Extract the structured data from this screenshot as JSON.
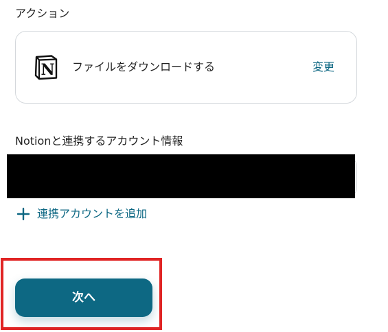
{
  "action_section": {
    "heading": "アクション",
    "app_icon": "notion-icon",
    "action_name": "ファイルをダウンロードする",
    "change_label": "変更"
  },
  "account_section": {
    "heading": "Notionと連携するアカウント情報",
    "add_account_label": "連携アカウントを追加",
    "add_icon": "plus-icon"
  },
  "footer": {
    "next_label": "次へ"
  },
  "colors": {
    "accent": "#0d6883",
    "link": "#0b6682",
    "highlight": "#e02424",
    "border": "#d4d8dc"
  }
}
